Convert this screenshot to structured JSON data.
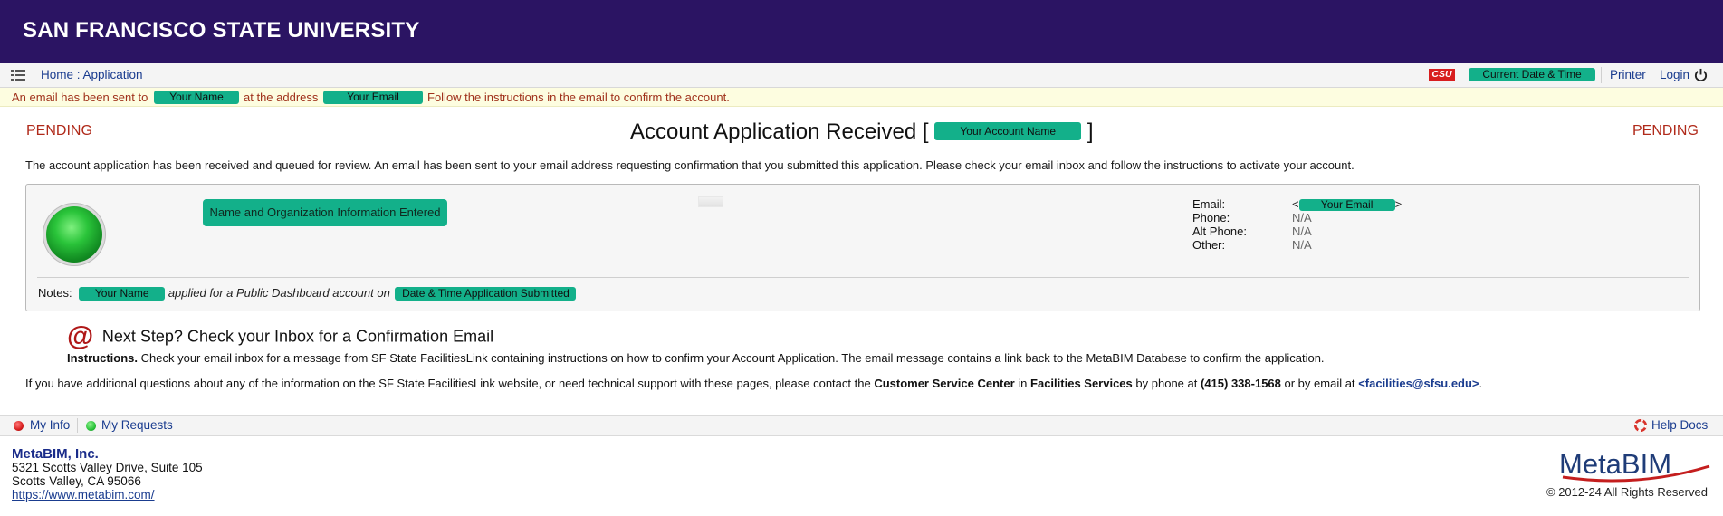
{
  "banner": {
    "university": "SAN FRANCISCO STATE UNIVERSITY"
  },
  "navbar": {
    "menu_icon": "list-menu-icon",
    "breadcrumb": "Home : Application",
    "csu_badge": "CSU",
    "datetime_placeholder": "Current Date & Time",
    "printer": "Printer",
    "login": "Login",
    "power_icon": "power-icon"
  },
  "alert": {
    "part1": "An email has been sent to",
    "name": "Your Name",
    "part2": "at the address",
    "email": "Your Email",
    "part3": "Follow the instructions in the email to confirm the account."
  },
  "status": {
    "left": "PENDING",
    "right": "PENDING"
  },
  "heading": {
    "title": "Account Application Received [",
    "account_name": "Your Account Name",
    "close": "]"
  },
  "intro": "The account application has been received and queued for review. An email has been sent to your email address requesting confirmation that you submitted this application. Please check your email inbox and follow the instructions to activate your account.",
  "panel": {
    "step_label": "Name and Organization Information Entered",
    "contact": {
      "email_label": "Email:",
      "email_lt": "<",
      "email_value": "Your Email",
      "email_gt": ">",
      "phone_label": "Phone:",
      "phone_value": "N/A",
      "alt_phone_label": "Alt Phone:",
      "alt_phone_value": "N/A",
      "other_label": "Other:",
      "other_value": "N/A"
    },
    "notes": {
      "label": "Notes:",
      "name": "Your Name",
      "text": "applied for a Public Dashboard account on",
      "date": "Date & Time Application Submitted"
    }
  },
  "next_step": {
    "icon": "at-sign-icon",
    "at": "@",
    "title": "Next Step? Check your Inbox for a Confirmation Email",
    "instructions_label": "Instructions.",
    "instructions_text": "Check your email inbox for a message from SF State FacilitiesLink containing instructions on how to confirm your Account Application. The email message contains a link back to the MetaBIM Database to confirm the application."
  },
  "help": {
    "t1": "If you have additional questions about any of the information on the SF State FacilitiesLink website, or need technical support with these pages, please contact the",
    "t2": "Customer Service Center",
    "t3": "in",
    "t4": "Facilities Services",
    "t5": "by phone at",
    "phone": "(415) 338-1568",
    "t6": "or by email at",
    "email": "<facilities@sfsu.edu>",
    "t7": "."
  },
  "footer": {
    "my_info": "My Info",
    "my_requests": "My Requests",
    "help_docs": "Help Docs",
    "company": {
      "name": "MetaBIM, Inc.",
      "address1": "5321 Scotts Valley Drive, Suite 105",
      "address2": "Scotts Valley, CA 95066",
      "url": "https://www.metabim.com/"
    },
    "logo_text": "MetaBIM",
    "copyright": "© 2012-24 All Rights Reserved"
  },
  "colors": {
    "banner": "#2b1463",
    "pill": "#13b08a",
    "alert_text": "#a0321c",
    "link": "#1a3c8f"
  }
}
